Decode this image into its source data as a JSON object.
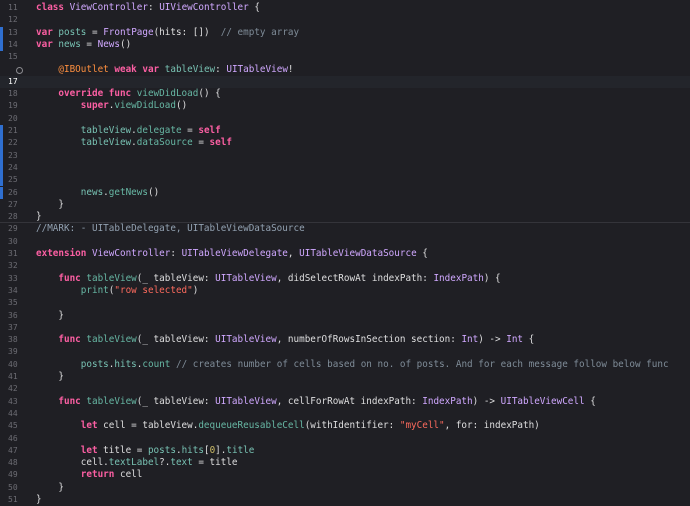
{
  "editor": {
    "language": "Swift",
    "current_line": 17,
    "colors": {
      "background": "#1f1f24",
      "current_line": "#23252b",
      "keyword": "#fc5fa3",
      "type": "#d0a8ff",
      "function": "#67b7a4",
      "string": "#fc6a5d",
      "comment": "#7f8c98",
      "attribute": "#fd8f3f",
      "change_bar": "#2f6fd0"
    },
    "lines": [
      {
        "n": 11,
        "bar": false,
        "tokens": [
          [
            "kw",
            "class"
          ],
          [
            "id",
            " "
          ],
          [
            "pt",
            "ViewController"
          ],
          [
            "id",
            ": "
          ],
          [
            "ty",
            "UIViewController"
          ],
          [
            "id",
            " {"
          ]
        ]
      },
      {
        "n": 12,
        "bar": false,
        "tokens": []
      },
      {
        "n": 13,
        "bar": true,
        "tokens": [
          [
            "kw",
            "var"
          ],
          [
            "id",
            " "
          ],
          [
            "pr",
            "posts"
          ],
          [
            "id",
            " = "
          ],
          [
            "ty",
            "FrontPage"
          ],
          [
            "id",
            "(hits: [])  "
          ],
          [
            "cm",
            "// empty array"
          ]
        ]
      },
      {
        "n": 14,
        "bar": true,
        "tokens": [
          [
            "kw",
            "var"
          ],
          [
            "id",
            " "
          ],
          [
            "pr",
            "news"
          ],
          [
            "id",
            " = "
          ],
          [
            "ty",
            "News"
          ],
          [
            "id",
            "()"
          ]
        ]
      },
      {
        "n": 15,
        "bar": false,
        "tokens": []
      },
      {
        "n": 16,
        "bar": false,
        "breakpoint": true,
        "tokens": [
          [
            "id",
            "    "
          ],
          [
            "at",
            "@IBOutlet"
          ],
          [
            "id",
            " "
          ],
          [
            "kw",
            "weak var"
          ],
          [
            "id",
            " "
          ],
          [
            "pr",
            "tableView"
          ],
          [
            "id",
            ": "
          ],
          [
            "ty",
            "UITableView"
          ],
          [
            "id",
            "!"
          ]
        ]
      },
      {
        "n": 17,
        "bar": false,
        "current": true,
        "tokens": []
      },
      {
        "n": 18,
        "bar": false,
        "tokens": [
          [
            "id",
            "    "
          ],
          [
            "kw",
            "override func"
          ],
          [
            "id",
            " "
          ],
          [
            "fn",
            "viewDidLoad"
          ],
          [
            "id",
            "() {"
          ]
        ]
      },
      {
        "n": 19,
        "bar": false,
        "tokens": [
          [
            "id",
            "        "
          ],
          [
            "kw",
            "super"
          ],
          [
            "id",
            "."
          ],
          [
            "fn",
            "viewDidLoad"
          ],
          [
            "id",
            "()"
          ]
        ]
      },
      {
        "n": 20,
        "bar": false,
        "tokens": []
      },
      {
        "n": 21,
        "bar": true,
        "tokens": [
          [
            "id",
            "        "
          ],
          [
            "pr",
            "tableView"
          ],
          [
            "id",
            "."
          ],
          [
            "fn",
            "delegate"
          ],
          [
            "id",
            " = "
          ],
          [
            "kw",
            "self"
          ]
        ]
      },
      {
        "n": 22,
        "bar": true,
        "tokens": [
          [
            "id",
            "        "
          ],
          [
            "pr",
            "tableView"
          ],
          [
            "id",
            "."
          ],
          [
            "fn",
            "dataSource"
          ],
          [
            "id",
            " = "
          ],
          [
            "kw",
            "self"
          ]
        ]
      },
      {
        "n": 23,
        "bar": true,
        "tokens": []
      },
      {
        "n": 24,
        "bar": true,
        "tokens": []
      },
      {
        "n": 25,
        "bar": true,
        "tokens": []
      },
      {
        "n": 26,
        "bar": true,
        "tokens": [
          [
            "id",
            "        "
          ],
          [
            "pr",
            "news"
          ],
          [
            "id",
            "."
          ],
          [
            "fn",
            "getNews"
          ],
          [
            "id",
            "()"
          ]
        ]
      },
      {
        "n": 27,
        "bar": false,
        "tokens": [
          [
            "id",
            "    }"
          ]
        ]
      },
      {
        "n": 28,
        "bar": false,
        "tokens": [
          [
            "id",
            "}"
          ]
        ]
      },
      {
        "n": 29,
        "bar": false,
        "sep": true,
        "tokens": [
          [
            "mk",
            "//MARK: - UITableDelegate, UITableViewDataSource"
          ]
        ]
      },
      {
        "n": 30,
        "bar": false,
        "tokens": []
      },
      {
        "n": 31,
        "bar": false,
        "tokens": [
          [
            "kw",
            "extension"
          ],
          [
            "id",
            " "
          ],
          [
            "pt",
            "ViewController"
          ],
          [
            "id",
            ": "
          ],
          [
            "ty",
            "UITableViewDelegate"
          ],
          [
            "id",
            ", "
          ],
          [
            "ty",
            "UITableViewDataSource"
          ],
          [
            "id",
            " {"
          ]
        ]
      },
      {
        "n": 32,
        "bar": false,
        "tokens": []
      },
      {
        "n": 33,
        "bar": false,
        "tokens": [
          [
            "id",
            "    "
          ],
          [
            "kw",
            "func"
          ],
          [
            "id",
            " "
          ],
          [
            "fn",
            "tableView"
          ],
          [
            "id",
            "(_ tableView: "
          ],
          [
            "ty",
            "UITableView"
          ],
          [
            "id",
            ", didSelectRowAt indexPath: "
          ],
          [
            "ty",
            "IndexPath"
          ],
          [
            "id",
            ") {"
          ]
        ]
      },
      {
        "n": 34,
        "bar": false,
        "tokens": [
          [
            "id",
            "        "
          ],
          [
            "fn",
            "print"
          ],
          [
            "id",
            "("
          ],
          [
            "st",
            "\"row selected\""
          ],
          [
            "id",
            ")"
          ]
        ]
      },
      {
        "n": 35,
        "bar": false,
        "tokens": []
      },
      {
        "n": 36,
        "bar": false,
        "tokens": [
          [
            "id",
            "    }"
          ]
        ]
      },
      {
        "n": 37,
        "bar": false,
        "tokens": []
      },
      {
        "n": 38,
        "bar": false,
        "tokens": [
          [
            "id",
            "    "
          ],
          [
            "kw",
            "func"
          ],
          [
            "id",
            " "
          ],
          [
            "fn",
            "tableView"
          ],
          [
            "id",
            "(_ tableView: "
          ],
          [
            "ty",
            "UITableView"
          ],
          [
            "id",
            ", numberOfRowsInSection section: "
          ],
          [
            "ty",
            "Int"
          ],
          [
            "id",
            ") -> "
          ],
          [
            "ty",
            "Int"
          ],
          [
            "id",
            " {"
          ]
        ]
      },
      {
        "n": 39,
        "bar": false,
        "tokens": []
      },
      {
        "n": 40,
        "bar": false,
        "tokens": [
          [
            "id",
            "        "
          ],
          [
            "pr",
            "posts"
          ],
          [
            "id",
            "."
          ],
          [
            "pr",
            "hits"
          ],
          [
            "id",
            "."
          ],
          [
            "fn",
            "count"
          ],
          [
            "id",
            " "
          ],
          [
            "cm",
            "// creates number of cells based on no. of posts. And for each message follow below func"
          ]
        ]
      },
      {
        "n": 41,
        "bar": false,
        "tokens": [
          [
            "id",
            "    }"
          ]
        ]
      },
      {
        "n": 42,
        "bar": false,
        "tokens": []
      },
      {
        "n": 43,
        "bar": false,
        "tokens": [
          [
            "id",
            "    "
          ],
          [
            "kw",
            "func"
          ],
          [
            "id",
            " "
          ],
          [
            "fn",
            "tableView"
          ],
          [
            "id",
            "(_ tableView: "
          ],
          [
            "ty",
            "UITableView"
          ],
          [
            "id",
            ", cellForRowAt indexPath: "
          ],
          [
            "ty",
            "IndexPath"
          ],
          [
            "id",
            ") -> "
          ],
          [
            "ty",
            "UITableViewCell"
          ],
          [
            "id",
            " {"
          ]
        ]
      },
      {
        "n": 44,
        "bar": false,
        "tokens": []
      },
      {
        "n": 45,
        "bar": false,
        "tokens": [
          [
            "id",
            "        "
          ],
          [
            "kw",
            "let"
          ],
          [
            "id",
            " cell = tableView."
          ],
          [
            "fn",
            "dequeueReusableCell"
          ],
          [
            "id",
            "(withIdentifier: "
          ],
          [
            "st",
            "\"myCell\""
          ],
          [
            "id",
            ", for: indexPath)"
          ]
        ]
      },
      {
        "n": 46,
        "bar": false,
        "tokens": []
      },
      {
        "n": 47,
        "bar": false,
        "tokens": [
          [
            "id",
            "        "
          ],
          [
            "kw",
            "let"
          ],
          [
            "id",
            " title = "
          ],
          [
            "pr",
            "posts"
          ],
          [
            "id",
            "."
          ],
          [
            "pr",
            "hits"
          ],
          [
            "id",
            "["
          ],
          [
            "num",
            "0"
          ],
          [
            "id",
            "]."
          ],
          [
            "pr",
            "title"
          ]
        ]
      },
      {
        "n": 48,
        "bar": false,
        "tokens": [
          [
            "id",
            "        cell."
          ],
          [
            "pr",
            "textLabel"
          ],
          [
            "id",
            "?."
          ],
          [
            "pr",
            "text"
          ],
          [
            "id",
            " = title"
          ]
        ]
      },
      {
        "n": 49,
        "bar": false,
        "tokens": [
          [
            "id",
            "        "
          ],
          [
            "kw",
            "return"
          ],
          [
            "id",
            " cell"
          ]
        ]
      },
      {
        "n": 50,
        "bar": false,
        "tokens": [
          [
            "id",
            "    }"
          ]
        ]
      },
      {
        "n": 51,
        "bar": false,
        "tokens": [
          [
            "id",
            "}"
          ]
        ]
      }
    ]
  }
}
